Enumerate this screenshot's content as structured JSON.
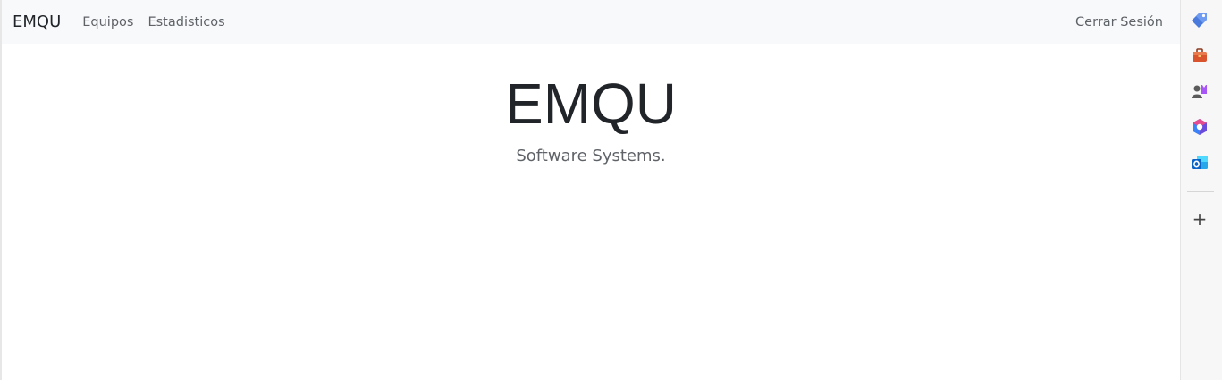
{
  "navbar": {
    "brand": "EMQU",
    "links": [
      "Equipos",
      "Estadisticos"
    ],
    "logout": "Cerrar Sesión"
  },
  "hero": {
    "title": "EMQU",
    "subtitle": "Software Systems."
  },
  "sidebar": {
    "icons": [
      "tag-icon",
      "briefcase-icon",
      "people-icon",
      "office-icon",
      "outlook-icon"
    ],
    "add_label": "+"
  },
  "colors": {
    "navbar_bg": "#f8f9fa",
    "text": "#212529",
    "muted": "#5f6368"
  }
}
